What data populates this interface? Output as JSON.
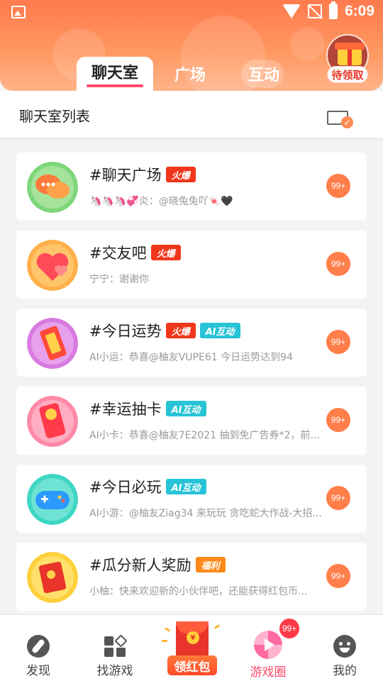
{
  "status_bar": {
    "time": "6:09"
  },
  "header": {
    "tabs": [
      {
        "label": "聊天室",
        "active": true
      },
      {
        "label": "广场",
        "active": false
      },
      {
        "label": "互动",
        "active": false
      }
    ],
    "gift_label": "待领取"
  },
  "subheader": {
    "title": "聊天室列表"
  },
  "rooms": [
    {
      "title": "#聊天广场",
      "badges": [
        "火爆"
      ],
      "subtitle": "🦄🦄🦄💞炎：@晓兔兔吖🍬🖤",
      "count": "99+"
    },
    {
      "title": "#交友吧",
      "badges": [
        "火爆"
      ],
      "subtitle": "宁宁：谢谢你",
      "count": "99+"
    },
    {
      "title": "#今日运势",
      "badges": [
        "火爆",
        "AI互动"
      ],
      "subtitle": "AI小运：恭喜@柚友VUPE61 今日运势达到94",
      "count": "99+"
    },
    {
      "title": "#幸运抽卡",
      "badges": [
        "AI互动"
      ],
      "subtitle": "AI小卡：恭喜@柚友7E2021 抽到免广告券*2，前...",
      "count": "99+"
    },
    {
      "title": "#今日必玩",
      "badges": [
        "AI互动"
      ],
      "subtitle": "AI小游：@柚友Ziag34 来玩玩 贪吃蛇大作战-大招...",
      "count": "99+"
    },
    {
      "title": "#瓜分新人奖励",
      "badges": [
        "福利"
      ],
      "subtitle": "小柚：快来欢迎新的小伙伴吧，还能获得红包币...",
      "count": "99+"
    }
  ],
  "bottom_nav": {
    "items": [
      {
        "label": "发现",
        "icon": "compass-icon"
      },
      {
        "label": "找游戏",
        "icon": "games-grid-icon"
      },
      {
        "label": "领红包",
        "icon": "red-envelope-icon"
      },
      {
        "label": "游戏圈",
        "icon": "game-circle-icon",
        "active": true
      },
      {
        "label": "我的",
        "icon": "profile-face-icon"
      }
    ],
    "circle_badge": "99+",
    "hongbao_coin": "¥"
  },
  "colors": {
    "accent": "#ff4a6a",
    "header": "#ff8a58",
    "hot": "#f2361b",
    "ai": "#27c3d6",
    "gift": "#ff8a1a",
    "count": "#ff7e4a"
  }
}
